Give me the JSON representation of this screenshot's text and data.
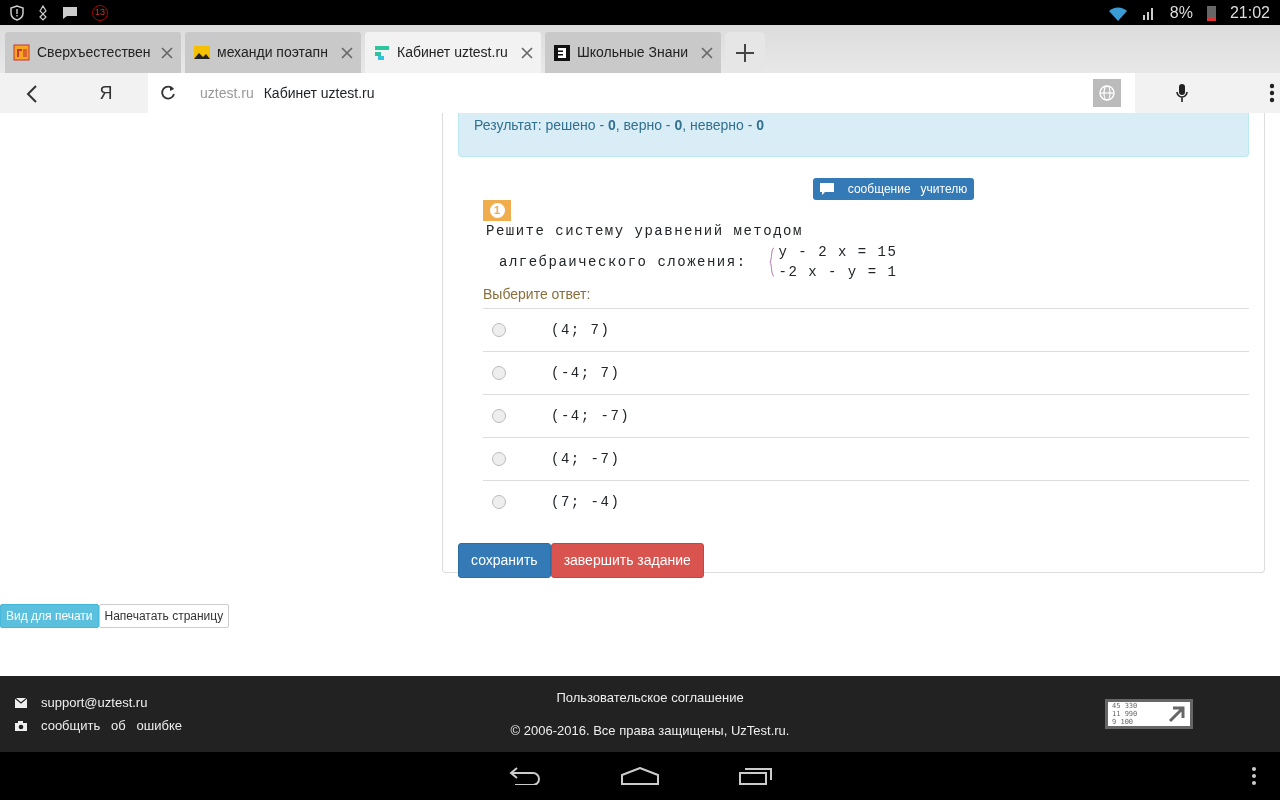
{
  "status_bar": {
    "notification_count": "13",
    "battery": "8%",
    "time": "21:02"
  },
  "tabs": [
    {
      "title": "Сверхъестествен",
      "selected": false
    },
    {
      "title": "механди поэтапн",
      "selected": false
    },
    {
      "title": "Кабинет uztest.ru",
      "selected": true
    },
    {
      "title": "Школьные Знани",
      "selected": false
    }
  ],
  "address_bar": {
    "domain": "uztest.ru",
    "title": "Кабинет uztest.ru",
    "back_label": "Я"
  },
  "result_alert": "Результат: решено - **0**, верно - **0**, неверно - **0**",
  "message_button": "сообщение   учителю",
  "question": {
    "number": "1",
    "line_1": "Решите систему уравнений методом",
    "line_2": "алгебраического сложения:",
    "equations": [
      "y - 2 x = 15",
      "-2 x - y = 1"
    ]
  },
  "prompt": "Выберите ответ:",
  "options": [
    {
      "label": "(4; 7)",
      "selected": false
    },
    {
      "label": "(-4; 7)",
      "selected": false
    },
    {
      "label": "(-4; -7)",
      "selected": false
    },
    {
      "label": "(4; -7)",
      "selected": false
    },
    {
      "label": "(7; -4)",
      "selected": false
    }
  ],
  "actions": [
    {
      "label": "сохранить",
      "kind": "primary"
    },
    {
      "label": "завершить задание",
      "kind": "danger"
    }
  ],
  "print_buttons": [
    {
      "label": "Вид для печати",
      "selected": true
    },
    {
      "label": "Напечатать страницу",
      "selected": false
    }
  ],
  "footer": {
    "email": "support@uztest.ru",
    "report": "сообщить   об   ошибке",
    "agreement": "Пользовательское соглашение",
    "copyright": "© 2006-2016. Все права защищены, UzTest.ru.",
    "counter": [
      "45 330",
      "11 990",
      "9 100"
    ]
  }
}
